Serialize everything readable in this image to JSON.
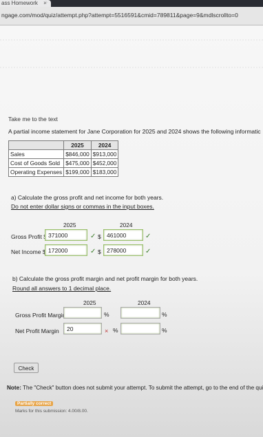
{
  "browser": {
    "tab_label": "ass Homework",
    "tab_close": "×",
    "new_tab": "+",
    "url": "ngage.com/mod/quiz/attempt.php?attempt=5516591&cmid=789811&page=9&mdlscrollto=0"
  },
  "quiz": {
    "take_me_link": "Take me to the text",
    "intro": "A partial income statement for Jane Corporation for 2025 and 2024 shows the following informatic",
    "table": {
      "headers": [
        "",
        "2025",
        "2024"
      ],
      "rows": [
        {
          "label": "Sales",
          "y2025": "$846,000",
          "y2024": "$913,000"
        },
        {
          "label": "Cost of Goods Sold",
          "y2025": "$475,000",
          "y2024": "$452,000"
        },
        {
          "label": "Operating Expenses",
          "y2025": "$199,000",
          "y2024": "$183,000"
        }
      ]
    },
    "part_a": {
      "question": "a) Calculate the gross profit and net income for both years.",
      "instruction": "Do not enter dollar signs or commas in the input boxes.",
      "year_2025": "2025",
      "year_2024": "2024",
      "gross_profit_label": "Gross Profit $",
      "net_income_label": "Net Income $",
      "dollar": "$",
      "gross_profit_2025": "371000",
      "gross_profit_2024": "461000",
      "net_income_2025": "172000",
      "net_income_2024": "278000",
      "check_glyph": "✓"
    },
    "part_b": {
      "question": "b) Calculate the gross profit margin and net profit margin for both years.",
      "instruction": "Round all answers to 1 decimal place.",
      "year_2025": "2025",
      "year_2024": "2024",
      "gross_margin_label": "Gross Profit Margin",
      "net_margin_label": "Net Profit Margin",
      "gross_margin_2025": "",
      "gross_margin_2024": "",
      "net_margin_2025": "20",
      "net_margin_2024": "",
      "percent": "%",
      "wrong_glyph": "×"
    },
    "check_button": "Check",
    "note_bold": "Note:",
    "note_text": " The \"Check\" button does not submit your attempt. To submit the attempt, go to the end of the qui",
    "status_badge": "Partially correct",
    "marks_text": "Marks for this submission: 4.00/8.00."
  }
}
